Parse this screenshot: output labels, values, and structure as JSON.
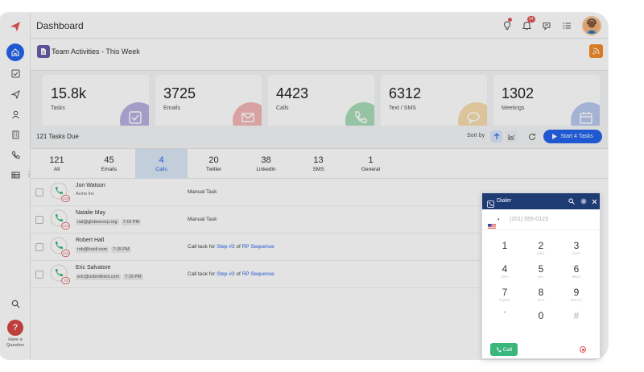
{
  "header": {
    "title": "Dashboard",
    "notif_count": "24"
  },
  "subheader": {
    "title": "Team Activities - This Week"
  },
  "stats": [
    {
      "value": "15.8k",
      "label": "Tasks",
      "color": "#b8b1e0",
      "icon": "checkbox-icon"
    },
    {
      "value": "3725",
      "label": "Emails",
      "color": "#f4b6b6",
      "icon": "envelope-icon"
    },
    {
      "value": "4423",
      "label": "Calls",
      "color": "#a8dcb8",
      "icon": "phone-icon"
    },
    {
      "value": "6312",
      "label": "Text / SMS",
      "color": "#f7dcae",
      "icon": "chat-icon"
    },
    {
      "value": "1302",
      "label": "Meetings",
      "color": "#b9c8ee",
      "icon": "calendar-icon"
    }
  ],
  "tasks": {
    "title": "121 Tasks Due",
    "sort_label": "Sort by",
    "start_label": "Start 4 Tasks"
  },
  "tabs": [
    {
      "count": "121",
      "label": "All"
    },
    {
      "count": "45",
      "label": "Emails"
    },
    {
      "count": "4",
      "label": "Calls"
    },
    {
      "count": "20",
      "label": "Twitter"
    },
    {
      "count": "38",
      "label": "Linkedin"
    },
    {
      "count": "13",
      "label": "SMS"
    },
    {
      "count": "1",
      "label": "General"
    }
  ],
  "rows": [
    {
      "name": "Jon Watson",
      "company": "Acme Inc",
      "email": "",
      "time": "",
      "tag": "144",
      "task": "Manual Task",
      "step": "",
      "seq": ""
    },
    {
      "name": "Natalie May",
      "company": "",
      "email": "nat@globexcorp.org",
      "time": "7:15 PM",
      "tag": "144",
      "task": "Manual Task",
      "step": "",
      "seq": ""
    },
    {
      "name": "Robert Hall",
      "company": "",
      "email": "rob@hooli.com",
      "time": "7:15 PM",
      "tag": "144",
      "task": "Call task for",
      "step": "Step #3",
      "of": "of",
      "seq": "RP Sequence"
    },
    {
      "name": "Eric Salvatore",
      "company": "",
      "email": "eric@svbrothers.com",
      "time": "7:15 PM",
      "tag": "7d",
      "task": "Call task for",
      "step": "Step #3",
      "of": "of",
      "seq": "RP Sequence"
    }
  ],
  "dialer": {
    "title": "Dialer",
    "placeholder": "(201) 555-0123",
    "call_label": "Call",
    "keys": [
      {
        "d": "1",
        "s": ""
      },
      {
        "d": "2",
        "s": "ABC"
      },
      {
        "d": "3",
        "s": "DEF"
      },
      {
        "d": "4",
        "s": "GHI"
      },
      {
        "d": "5",
        "s": "JKL"
      },
      {
        "d": "6",
        "s": "MNO"
      },
      {
        "d": "7",
        "s": "PQRS"
      },
      {
        "d": "8",
        "s": "TUV"
      },
      {
        "d": "9",
        "s": "WXYZ"
      },
      {
        "d": "*",
        "s": ""
      },
      {
        "d": "0",
        "s": ""
      },
      {
        "d": "#",
        "s": ""
      }
    ]
  },
  "help": {
    "label": "Have a Question"
  },
  "colors": {
    "primary": "#2563eb",
    "accent": "#e25555",
    "dialer_header": "#1f3b73",
    "call": "#3bb77e"
  }
}
